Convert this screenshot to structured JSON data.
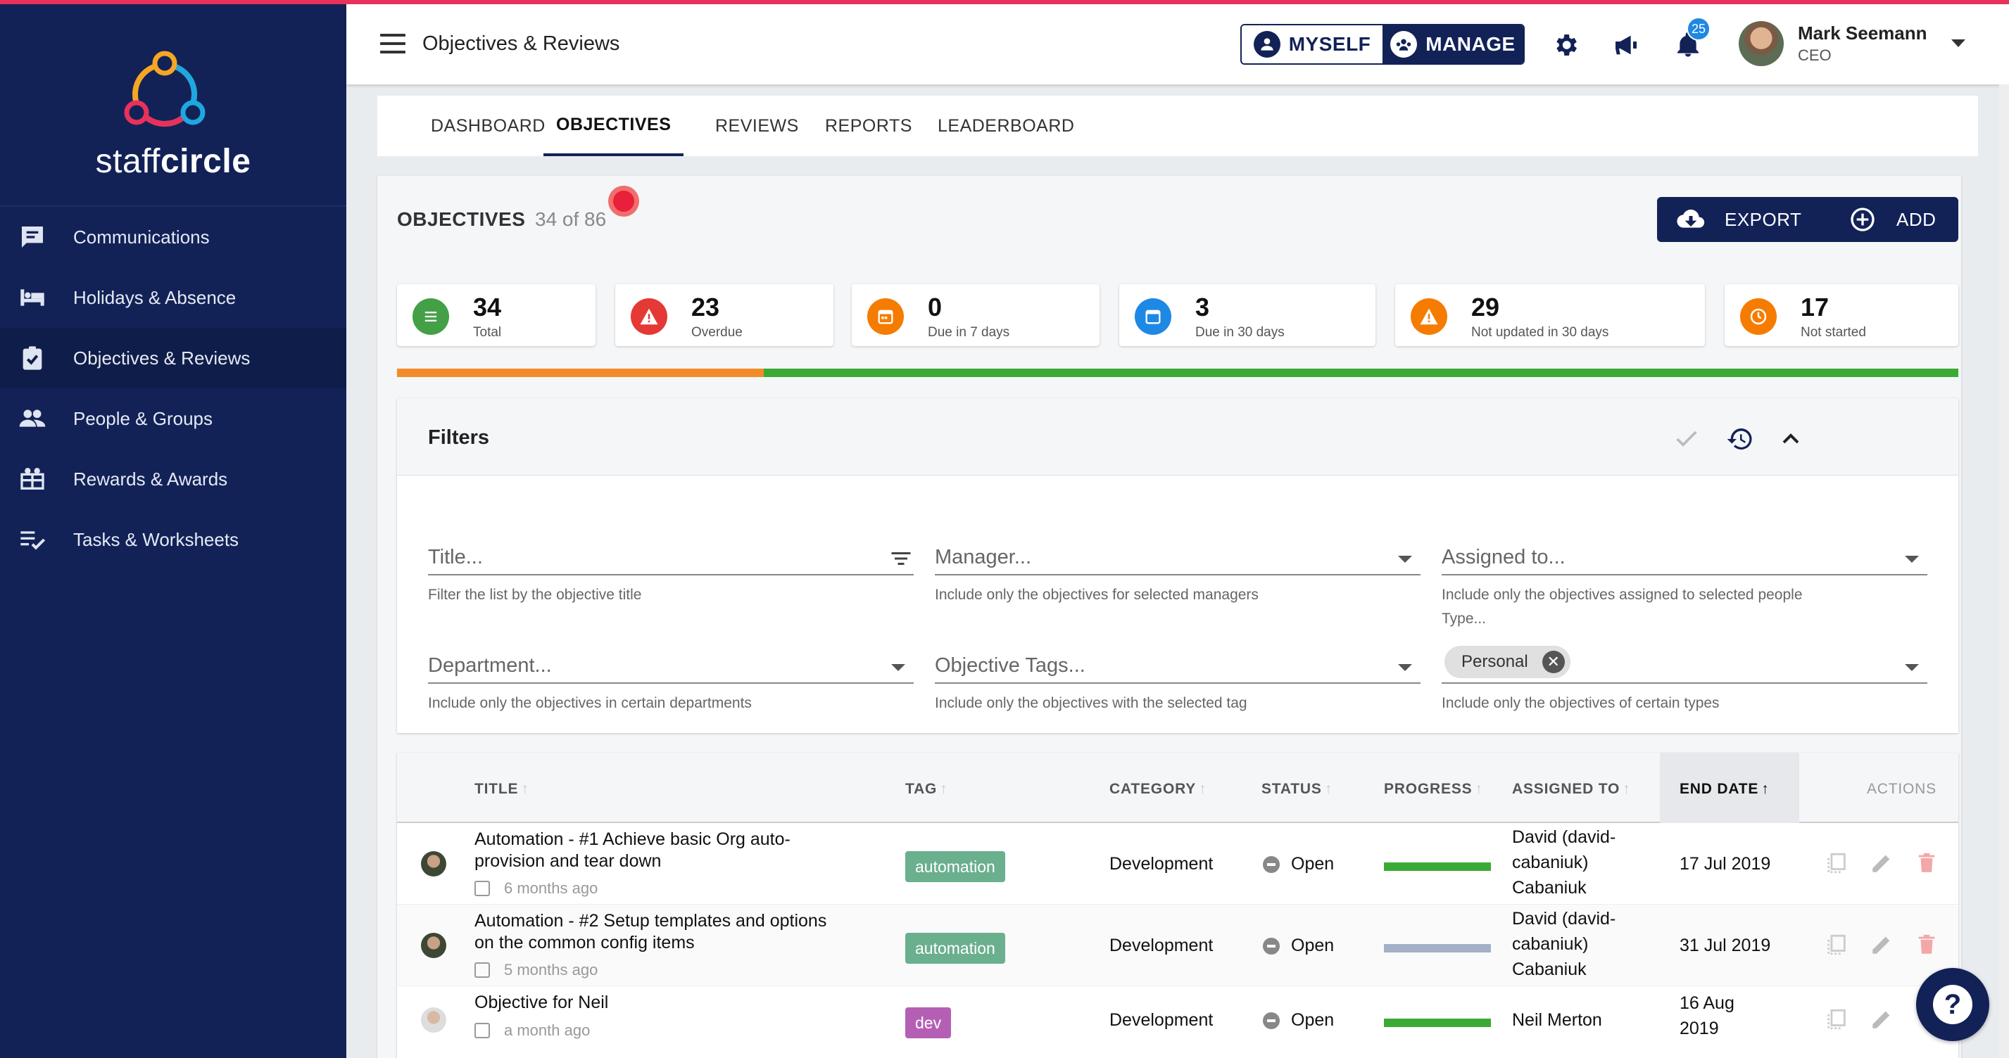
{
  "brand": {
    "name_light": "staff",
    "name_bold": "circle"
  },
  "sidebar": {
    "items": [
      {
        "label": "Communications",
        "icon": "chat-icon"
      },
      {
        "label": "Holidays & Absence",
        "icon": "bed-icon"
      },
      {
        "label": "Objectives & Reviews",
        "icon": "clipboard-check-icon",
        "active": true
      },
      {
        "label": "People & Groups",
        "icon": "people-icon"
      },
      {
        "label": "Rewards & Awards",
        "icon": "gift-icon"
      },
      {
        "label": "Tasks & Worksheets",
        "icon": "checklist-icon"
      }
    ]
  },
  "header": {
    "title": "Objectives & Reviews",
    "myself_label": "MYSELF",
    "manage_label": "MANAGE",
    "notification_count": "25",
    "user_name": "Mark Seemann",
    "user_role": "CEO"
  },
  "tabs": [
    "DASHBOARD",
    "OBJECTIVES",
    "REVIEWS",
    "REPORTS",
    "LEADERBOARD"
  ],
  "objectives": {
    "title": "OBJECTIVES",
    "count": "34 of 86",
    "export_label": "EXPORT",
    "add_label": "ADD"
  },
  "stats": [
    {
      "value": "34",
      "label": "Total",
      "color": "#43a047"
    },
    {
      "value": "23",
      "label": "Overdue",
      "color": "#e53935"
    },
    {
      "value": "0",
      "label": "Due in 7 days",
      "color": "#f57c00"
    },
    {
      "value": "3",
      "label": "Due in 30 days",
      "color": "#1e88e5"
    },
    {
      "value": "29",
      "label": "Not updated in 30 days",
      "color": "#f57c00"
    },
    {
      "value": "17",
      "label": "Not started",
      "color": "#f57c00"
    }
  ],
  "overall_progress": {
    "orange_fraction": 0.235,
    "orange": "#f28c28",
    "green": "#3aaa35"
  },
  "filters": {
    "title": "Filters",
    "title_placeholder": "Title...",
    "title_hint": "Filter the list by the objective title",
    "manager_placeholder": "Manager...",
    "manager_hint": "Include only the objectives for selected managers",
    "assigned_placeholder": "Assigned to...",
    "assigned_hint": "Include only the objectives assigned to selected people",
    "department_placeholder": "Department...",
    "department_hint": "Include only the objectives in certain departments",
    "tags_placeholder": "Objective Tags...",
    "tags_hint": "Include only the objectives with the selected tag",
    "type_label": "Type...",
    "type_chip": "Personal",
    "type_hint": "Include only the objectives of certain types"
  },
  "table": {
    "columns": {
      "title": "TITLE",
      "tag": "TAG",
      "category": "CATEGORY",
      "status": "STATUS",
      "progress": "PROGRESS",
      "assigned_to": "ASSIGNED TO",
      "end_date": "END DATE",
      "actions": "ACTIONS"
    },
    "rows": [
      {
        "title": "Automation - #1 Achieve basic Org auto-provision and tear down",
        "time": "6 months ago",
        "tag": "automation",
        "tag_color": "#6aaf8e",
        "category": "Development",
        "status": "Open",
        "progress_color": "#3aaa35",
        "assigned": "David (david-cabaniuk) Cabaniuk",
        "end_date": "17 Jul 2019"
      },
      {
        "title": "Automation - #2 Setup templates and options on the common config items",
        "time": "5 months ago",
        "tag": "automation",
        "tag_color": "#6aaf8e",
        "category": "Development",
        "status": "Open",
        "progress_color": "#a4b0c8",
        "assigned": "David (david-cabaniuk) Cabaniuk",
        "end_date": "31 Jul 2019"
      },
      {
        "title": "Objective for Neil",
        "time": "a month ago",
        "tag": "dev",
        "tag_color": "#b45fb4",
        "category": "Development",
        "status": "Open",
        "progress_color": "#3aaa35",
        "assigned": "Neil Merton",
        "end_date": "16 Aug 2019"
      }
    ]
  }
}
